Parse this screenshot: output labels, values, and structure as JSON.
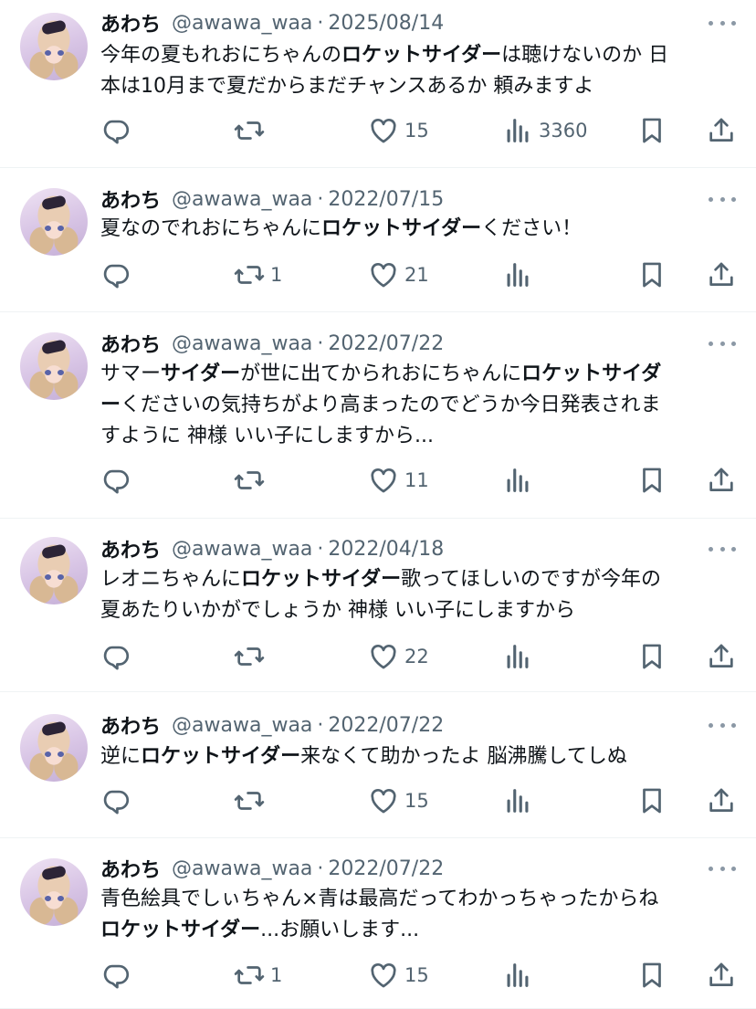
{
  "tweets": [
    {
      "name": "あわち",
      "handle": "@awawa_waa",
      "separator": "·",
      "date": "2025/08/14",
      "lines": [
        [
          {
            "text": "今年の夏もれおにちゃんの",
            "bold": false
          },
          {
            "text": "ロケットサイダー",
            "bold": true
          },
          {
            "text": "は聴けないのか 日",
            "bold": false
          }
        ],
        [
          {
            "text": "本は10月まで夏だからまだチャンスあるか 頼みますよ",
            "bold": false
          }
        ]
      ],
      "counts": {
        "reply": "",
        "retweet": "",
        "like": "15",
        "views": "3360"
      }
    },
    {
      "name": "あわち",
      "handle": "@awawa_waa",
      "separator": "·",
      "date": "2022/07/15",
      "lines": [
        [
          {
            "text": "夏なのでれおにちゃんに",
            "bold": false
          },
          {
            "text": "ロケットサイダー",
            "bold": true
          },
          {
            "text": "ください！",
            "bold": false
          }
        ]
      ],
      "counts": {
        "reply": "",
        "retweet": "1",
        "like": "21",
        "views": ""
      }
    },
    {
      "name": "あわち",
      "handle": "@awawa_waa",
      "separator": "·",
      "date": "2022/07/22",
      "lines": [
        [
          {
            "text": "サマー",
            "bold": false
          },
          {
            "text": "サイダー",
            "bold": true
          },
          {
            "text": "が世に出てかられおにちゃんに",
            "bold": false
          },
          {
            "text": "ロケットサイダ",
            "bold": true
          }
        ],
        [
          {
            "text": "ー",
            "bold": true
          },
          {
            "text": "くださいの気持ちがより高まったのでどうか今日発表されま",
            "bold": false
          }
        ],
        [
          {
            "text": "すように 神様 いい子にしますから...",
            "bold": false
          }
        ]
      ],
      "counts": {
        "reply": "",
        "retweet": "",
        "like": "11",
        "views": ""
      }
    },
    {
      "name": "あわち",
      "handle": "@awawa_waa",
      "separator": "·",
      "date": "2022/04/18",
      "lines": [
        [
          {
            "text": "レオニちゃんに",
            "bold": false
          },
          {
            "text": "ロケットサイダー",
            "bold": true
          },
          {
            "text": "歌ってほしいのですが今年の",
            "bold": false
          }
        ],
        [
          {
            "text": "夏あたりいかがでしょうか 神様 いい子にしますから",
            "bold": false
          }
        ]
      ],
      "counts": {
        "reply": "",
        "retweet": "",
        "like": "22",
        "views": ""
      }
    },
    {
      "name": "あわち",
      "handle": "@awawa_waa",
      "separator": "·",
      "date": "2022/07/22",
      "lines": [
        [
          {
            "text": "逆に",
            "bold": false
          },
          {
            "text": "ロケットサイダー",
            "bold": true
          },
          {
            "text": "来なくて助かったよ 脳沸騰してしぬ",
            "bold": false
          }
        ]
      ],
      "counts": {
        "reply": "",
        "retweet": "",
        "like": "15",
        "views": ""
      }
    },
    {
      "name": "あわち",
      "handle": "@awawa_waa",
      "separator": "·",
      "date": "2022/07/22",
      "lines": [
        [
          {
            "text": "青色絵具でしぃちゃん×青は最高だってわかっちゃったからね",
            "bold": false
          }
        ],
        [
          {
            "text": "ロケットサイダー",
            "bold": true
          },
          {
            "text": "...お願いします...",
            "bold": false
          }
        ]
      ],
      "counts": {
        "reply": "",
        "retweet": "1",
        "like": "15",
        "views": ""
      }
    }
  ],
  "icons": {
    "reply": "reply-icon",
    "retweet": "retweet-icon",
    "like": "heart-icon",
    "views": "views-icon",
    "bookmark": "bookmark-icon",
    "share": "share-icon",
    "more": "more-icon"
  },
  "colors": {
    "text": "#0f1419",
    "muted": "#536471",
    "divider": "#eff3f4"
  }
}
